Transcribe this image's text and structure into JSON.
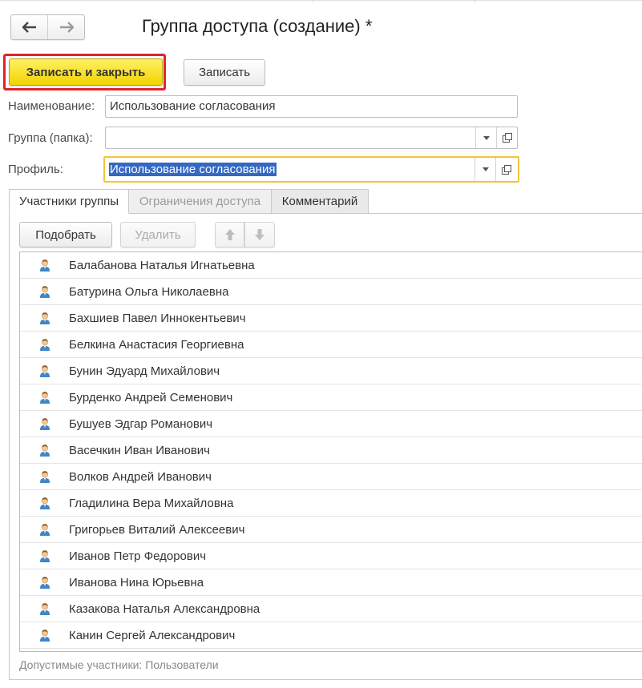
{
  "window": {
    "title": "Группа доступа (создание) *"
  },
  "toolbar": {
    "save_close_label": "Записать и закрыть",
    "save_label": "Записать"
  },
  "form": {
    "name_label": "Наименование:",
    "name_value": "Использование согласования",
    "group_label": "Группа (папка):",
    "group_value": "",
    "profile_label": "Профиль:",
    "profile_value": "Использование согласования"
  },
  "tabs": [
    {
      "label": "Участники группы",
      "state": "active"
    },
    {
      "label": "Ограничения доступа",
      "state": "disabled"
    },
    {
      "label": "Комментарий",
      "state": "normal"
    }
  ],
  "members_toolbar": {
    "pick_label": "Подобрать",
    "delete_label": "Удалить"
  },
  "members": [
    "Балабанова Наталья Игнатьевна",
    "Батурина Ольга Николаевна",
    "Бахшиев Павел Иннокентьевич",
    "Белкина Анастасия Георгиевна",
    "Бунин Эдуард Михайлович",
    "Бурденко Андрей Семенович",
    "Бушуев Эдгар Романович",
    "Васечкин Иван Иванович",
    "Волков Андрей Иванович",
    "Гладилина Вера Михайловна",
    "Григорьев Виталий Алексеевич",
    "Иванов Петр Федорович",
    "Иванова Нина Юрьевна",
    "Казакова Наталья Александровна",
    "Канин Сергей Александрович"
  ],
  "footer": {
    "note": "Допустимые участники: Пользователи"
  },
  "colors": {
    "primary_button": "#f2d400",
    "focus_ring": "#e0242a",
    "selection": "#3468c2",
    "active_field_border": "#f3c53e"
  },
  "icons": {
    "back": "arrow-left-icon",
    "forward": "arrow-right-icon",
    "dropdown": "chevron-down-icon",
    "open": "open-form-icon",
    "move_up": "arrow-up-icon",
    "move_down": "arrow-down-icon",
    "member": "user-icon"
  }
}
